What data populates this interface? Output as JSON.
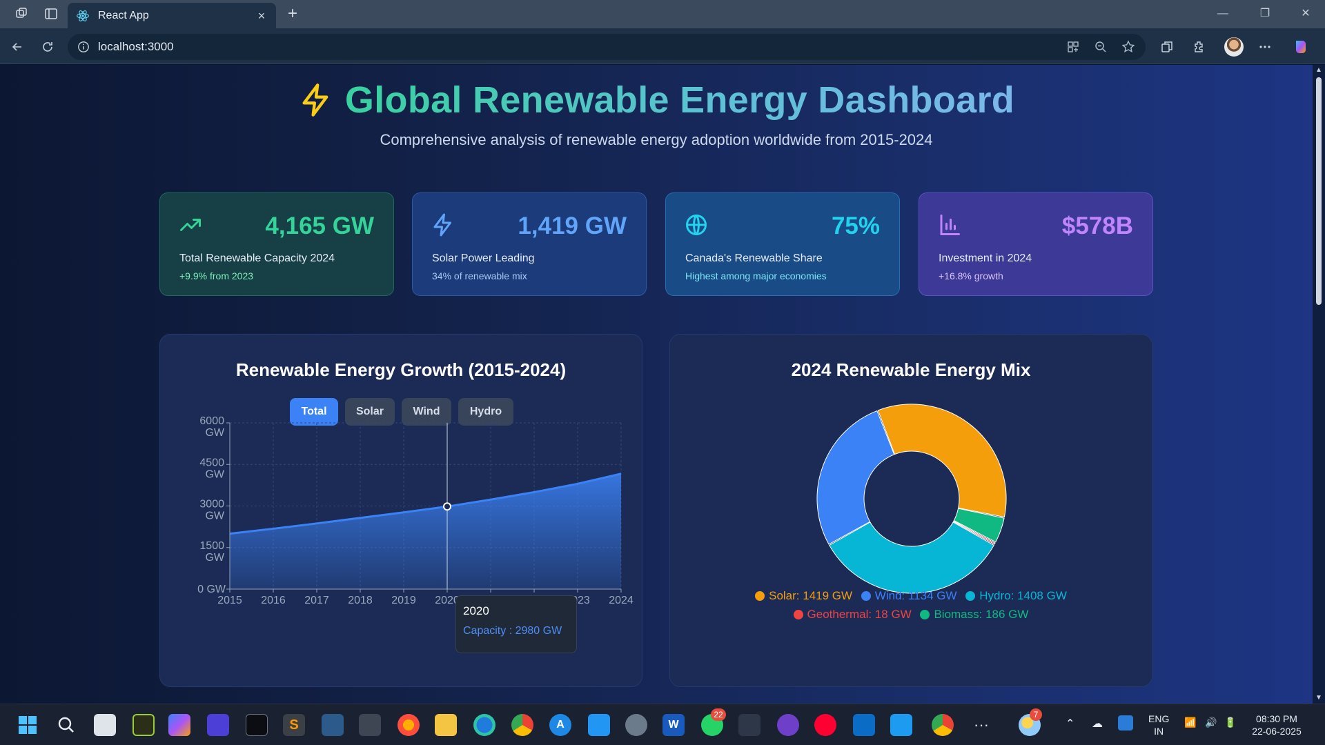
{
  "browser": {
    "tab_title": "React App",
    "url": "localhost:3000"
  },
  "header": {
    "title": "Global Renewable Energy Dashboard",
    "subtitle": "Comprehensive analysis of renewable energy adoption worldwide from 2015-2024"
  },
  "stats": [
    {
      "value": "4,165 GW",
      "label": "Total Renewable Capacity 2024",
      "note": "+9.9% from 2023",
      "icon": "trending-up-icon",
      "accent": "#34d399",
      "note_color": "#7ef0b8"
    },
    {
      "value": "1,419 GW",
      "label": "Solar Power Leading",
      "note": "34% of renewable mix",
      "icon": "zap-icon",
      "accent": "#60a5fa",
      "note_color": "#a8c8f6"
    },
    {
      "value": "75%",
      "label": "Canada's Renewable Share",
      "note": "Highest among major economies",
      "icon": "globe-icon",
      "accent": "#22d3ee",
      "note_color": "#7fe5f5"
    },
    {
      "value": "$578B",
      "label": "Investment in 2024",
      "note": "+16.8% growth",
      "icon": "bar-chart-icon",
      "accent": "#c084fc",
      "note_color": "#dcc3ff"
    }
  ],
  "growth_panel": {
    "title": "Renewable Energy Growth (2015-2024)",
    "toggles": [
      "Total",
      "Solar",
      "Wind",
      "Hydro"
    ],
    "active_toggle": "Total",
    "tooltip": {
      "label": "2020",
      "series": "Capacity",
      "value": "2980 GW"
    }
  },
  "mix_panel": {
    "title": "2024 Renewable Energy Mix",
    "legend": [
      {
        "text": "Solar: 1419 GW",
        "color": "#f59e0b"
      },
      {
        "text": "Wind: 1134 GW",
        "color": "#3b82f6"
      },
      {
        "text": "Hydro: 1408 GW",
        "color": "#06b6d4"
      },
      {
        "text": "Geothermal: 18 GW",
        "color": "#ef4444"
      },
      {
        "text": "Biomass: 186 GW",
        "color": "#10b981"
      }
    ]
  },
  "chart_data": [
    {
      "type": "area",
      "title": "Renewable Energy Growth (2015-2024)",
      "x": [
        2015,
        2016,
        2017,
        2018,
        2019,
        2020,
        2021,
        2022,
        2023,
        2024
      ],
      "series": [
        {
          "name": "Capacity",
          "values": [
            2000,
            2180,
            2370,
            2570,
            2770,
            2980,
            3230,
            3500,
            3800,
            4165
          ]
        }
      ],
      "yticks": [
        "0 GW",
        "1500 GW",
        "3000 GW",
        "4500 GW",
        "6000 GW"
      ],
      "ylim": [
        0,
        6000
      ],
      "grid": true,
      "color": "#3b82f6",
      "highlight_index": 5
    },
    {
      "type": "pie",
      "title": "2024 Renewable Energy Mix",
      "categories": [
        "Solar",
        "Biomass",
        "Geothermal",
        "Hydro",
        "Wind"
      ],
      "values": [
        1419,
        186,
        18,
        1408,
        1134
      ],
      "colors": [
        "#f59e0b",
        "#10b981",
        "#ef4444",
        "#06b6d4",
        "#3b82f6"
      ],
      "legend": "bottom"
    }
  ],
  "taskbar": {
    "time": "08:30 PM",
    "date": "22-06-2025",
    "lang": "ENG",
    "region": "IN",
    "whatsapp_badge": "22",
    "weather_badge": "7"
  }
}
